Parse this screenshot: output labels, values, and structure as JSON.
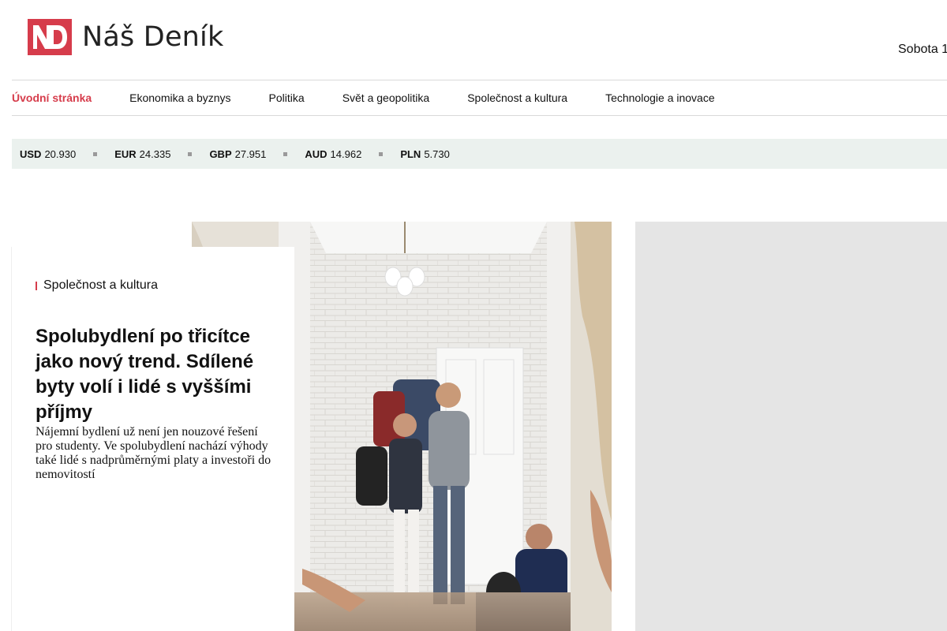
{
  "header": {
    "brand_name": "Náš Deník",
    "logo_mark": "ND",
    "date_text": "Sobota 1"
  },
  "nav": {
    "items": [
      {
        "label": "Úvodní stránka",
        "active": true
      },
      {
        "label": "Ekonomika a byznys"
      },
      {
        "label": "Politika"
      },
      {
        "label": "Svět a geopolitika"
      },
      {
        "label": "Společnost a kultura"
      },
      {
        "label": "Technologie a inovace"
      }
    ]
  },
  "currencies": [
    {
      "code": "USD",
      "value": "20.930"
    },
    {
      "code": "EUR",
      "value": "24.335"
    },
    {
      "code": "GBP",
      "value": "27.951"
    },
    {
      "code": "AUD",
      "value": "14.962"
    },
    {
      "code": "PLN",
      "value": "5.730"
    }
  ],
  "featured": {
    "category": "Společnost a kultura",
    "title": "Spolubydlení po třicítce jako nový trend. Sdílené byty volí i lidé s vyššími příjmy",
    "perex": "Nájemní bydlení už není jen nouzové řešení pro studenty. Ve spolubydlení nachází výhody také lidé s nadprůměrnými platy a investoři do nemovitostí"
  },
  "colors": {
    "brand": "#d63c4b",
    "currency_bar": "#ebf1ee",
    "ad_placeholder": "#e5e5e5",
    "divider": "#d9d9d9"
  },
  "icons": {
    "logo": "nd-logo-icon",
    "separator": "square-separator-icon"
  }
}
